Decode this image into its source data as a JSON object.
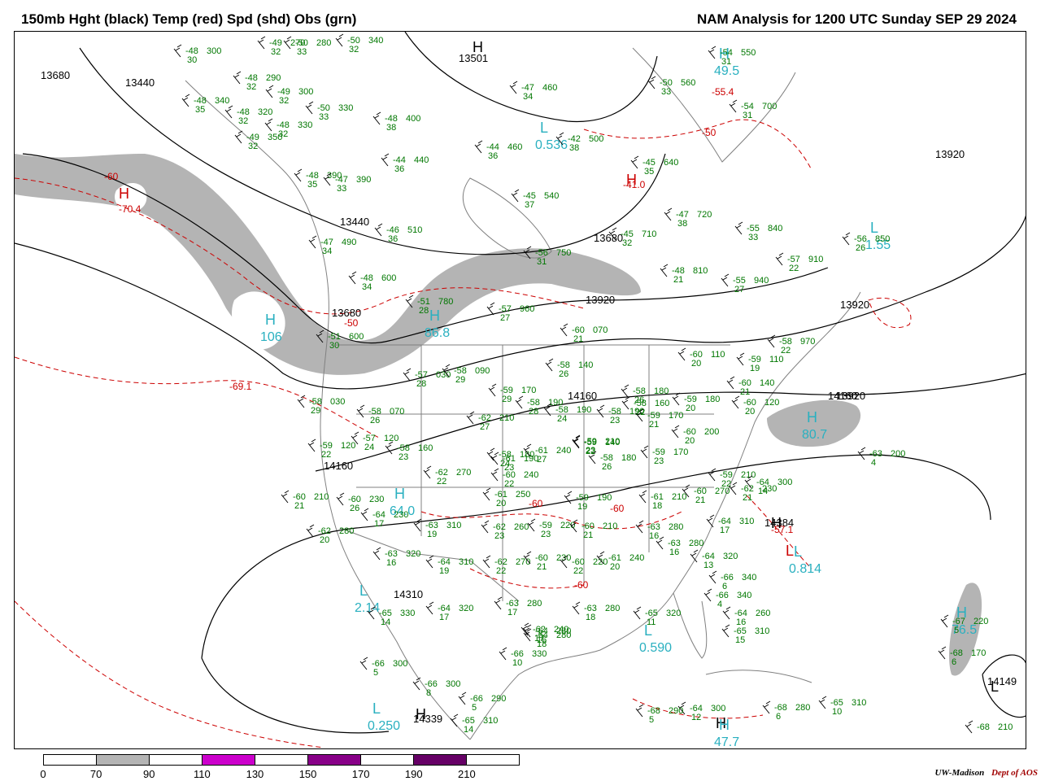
{
  "header": {
    "left_title": "150mb Hght (black) Temp (red) Spd (shd) Obs (grn)",
    "right_title": "NAM Analysis for 1200 UTC Sunday  SEP 29 2024"
  },
  "colors": {
    "height_contour": "#000000",
    "temp_contour": "#cc0000",
    "speed_shade_70_90": "#b4b4b4",
    "obs": "#007700",
    "center_label": "#2ab0c0",
    "map_borders": "#808080"
  },
  "colorbar": {
    "ticks": [
      "0",
      "70",
      "90",
      "110",
      "130",
      "150",
      "170",
      "190",
      "210"
    ],
    "segment_colors": [
      "#ffffff",
      "#b4b4b4",
      "#ffffff",
      "#cc00cc",
      "#ffffff",
      "#880088",
      "#ffffff",
      "#660066",
      "#ffffff"
    ]
  },
  "height_labels": [
    "13680",
    "13440",
    "13501",
    "13920",
    "13680",
    "13440",
    "13920",
    "13680",
    "13920",
    "13920",
    "14160",
    "14160",
    "14160",
    "14160",
    "14384",
    "14310",
    "14339",
    "14149"
  ],
  "temp_labels": [
    "-60",
    "-70.4",
    "-50",
    "-50",
    "-55.4",
    "-41.0",
    "-69.1",
    "-60",
    "-60",
    "-60",
    "-57.1"
  ],
  "centers": [
    {
      "letter": "H",
      "value": "49.5",
      "kind": "speed"
    },
    {
      "letter": "H",
      "value": "",
      "kind": "height"
    },
    {
      "letter": "L",
      "value": "0.536",
      "kind": "speed"
    },
    {
      "letter": "H",
      "value": "",
      "kind": "temp"
    },
    {
      "letter": "H",
      "value": "",
      "kind": "temp"
    },
    {
      "letter": "L",
      "value": "1.55",
      "kind": "speed"
    },
    {
      "letter": "H",
      "value": "106",
      "kind": "speed"
    },
    {
      "letter": "H",
      "value": "86.8",
      "kind": "speed"
    },
    {
      "letter": "H",
      "value": "80.7",
      "kind": "speed"
    },
    {
      "letter": "H",
      "value": "64.0",
      "kind": "speed"
    },
    {
      "letter": "L",
      "value": "",
      "kind": "temp"
    },
    {
      "letter": "H",
      "value": "",
      "kind": "height"
    },
    {
      "letter": "L",
      "value": "0.814",
      "kind": "speed"
    },
    {
      "letter": "L",
      "value": "2.14",
      "kind": "speed"
    },
    {
      "letter": "H",
      "value": "",
      "kind": "height"
    },
    {
      "letter": "L",
      "value": "0.590",
      "kind": "speed"
    },
    {
      "letter": "L",
      "value": "0.250",
      "kind": "speed"
    },
    {
      "letter": "H",
      "value": "",
      "kind": "height"
    },
    {
      "letter": "H",
      "value": "47.7",
      "kind": "speed"
    },
    {
      "letter": "H",
      "value": "76.5",
      "kind": "speed"
    },
    {
      "letter": "L",
      "value": "",
      "kind": "height"
    }
  ],
  "stations": [
    {
      "t": "-48",
      "h": "300",
      "d": "30"
    },
    {
      "t": "-49",
      "h": "270",
      "d": "32"
    },
    {
      "t": "-50",
      "h": "280",
      "d": "33"
    },
    {
      "t": "-50",
      "h": "340",
      "d": "32"
    },
    {
      "t": "-48",
      "h": "290",
      "d": "32"
    },
    {
      "t": "-49",
      "h": "300",
      "d": "32"
    },
    {
      "t": "-48",
      "h": "340",
      "d": "35"
    },
    {
      "t": "-48",
      "h": "320",
      "d": "32"
    },
    {
      "t": "-50",
      "h": "330",
      "d": "33"
    },
    {
      "t": "-48",
      "h": "330",
      "d": "32"
    },
    {
      "t": "-49",
      "h": "350",
      "d": "32"
    },
    {
      "t": "-48",
      "h": "400",
      "d": "38"
    },
    {
      "t": "-47",
      "h": "460",
      "d": "34"
    },
    {
      "t": "-44",
      "h": "460",
      "d": "36"
    },
    {
      "t": "-42",
      "h": "500",
      "d": "38"
    },
    {
      "t": "-44",
      "h": "440",
      "d": "36"
    },
    {
      "t": "-48",
      "h": "390",
      "d": "35"
    },
    {
      "t": "-47",
      "h": "390",
      "d": "33"
    },
    {
      "t": "-45",
      "h": "540",
      "d": "37"
    },
    {
      "t": "-45",
      "h": "640",
      "d": "35"
    },
    {
      "t": "-50",
      "h": "560",
      "d": "33"
    },
    {
      "t": "-54",
      "h": "550",
      "d": "31"
    },
    {
      "t": "-54",
      "h": "700",
      "d": "31"
    },
    {
      "t": "-46",
      "h": "510",
      "d": "36"
    },
    {
      "t": "-47",
      "h": "490",
      "d": "34"
    },
    {
      "t": "-47",
      "h": "720",
      "d": "38"
    },
    {
      "t": "-45",
      "h": "710",
      "d": "32"
    },
    {
      "t": "-55",
      "h": "840",
      "d": "33"
    },
    {
      "t": "-56",
      "h": "850",
      "d": "26"
    },
    {
      "t": "-48",
      "h": "600",
      "d": "34"
    },
    {
      "t": "-56",
      "h": "750",
      "d": "31"
    },
    {
      "t": "-48",
      "h": "810",
      "d": "21"
    },
    {
      "t": "-57",
      "h": "910",
      "d": "22"
    },
    {
      "t": "-55",
      "h": "940",
      "d": "27"
    },
    {
      "t": "-51",
      "h": "780",
      "d": "28"
    },
    {
      "t": "-57",
      "h": "960",
      "d": "27"
    },
    {
      "t": "-60",
      "h": "070",
      "d": "21"
    },
    {
      "t": "-58",
      "h": "970",
      "d": "22"
    },
    {
      "t": "-51",
      "h": "600",
      "d": "30"
    },
    {
      "t": "-57",
      "h": "030",
      "d": "28"
    },
    {
      "t": "-58",
      "h": "090",
      "d": "29"
    },
    {
      "t": "-58",
      "h": "140",
      "d": "26"
    },
    {
      "t": "-60",
      "h": "110",
      "d": "20"
    },
    {
      "t": "-59",
      "h": "110",
      "d": "19"
    },
    {
      "t": "-59",
      "h": "170",
      "d": "29"
    },
    {
      "t": "-58",
      "h": "190",
      "d": "28"
    },
    {
      "t": "-58",
      "h": "190",
      "d": "24"
    },
    {
      "t": "-58",
      "h": "190",
      "d": "23"
    },
    {
      "t": "-58",
      "h": "180",
      "d": "26"
    },
    {
      "t": "-60",
      "h": "140",
      "d": "21"
    },
    {
      "t": "-60",
      "h": "120",
      "d": "20"
    },
    {
      "t": "-58",
      "h": "030",
      "d": "29"
    },
    {
      "t": "-58",
      "h": "070",
      "d": "26"
    },
    {
      "t": "-62",
      "h": "210",
      "d": "27"
    },
    {
      "t": "-58",
      "h": "160",
      "d": "22"
    },
    {
      "t": "-59",
      "h": "170",
      "d": "21"
    },
    {
      "t": "-59",
      "h": "180",
      "d": "20"
    },
    {
      "t": "-60",
      "h": "200",
      "d": "20"
    },
    {
      "t": "-59",
      "h": "120",
      "d": "22"
    },
    {
      "t": "-57",
      "h": "120",
      "d": "24"
    },
    {
      "t": "-58",
      "h": "160",
      "d": "23"
    },
    {
      "t": "-58",
      "h": "180",
      "d": "24"
    },
    {
      "t": "-61",
      "h": "190",
      "d": "23"
    },
    {
      "t": "-61",
      "h": "240",
      "d": "27"
    },
    {
      "t": "-59",
      "h": "210",
      "d": "23"
    },
    {
      "t": "-58",
      "h": "180",
      "d": "26"
    },
    {
      "t": "-59",
      "h": "170",
      "d": "23"
    },
    {
      "t": "-59",
      "h": "140",
      "d": "22"
    },
    {
      "t": "-60",
      "h": "240",
      "d": "22"
    },
    {
      "t": "-62",
      "h": "270",
      "d": "22"
    },
    {
      "t": "-59",
      "h": "210",
      "d": "22"
    },
    {
      "t": "-62",
      "h": "230",
      "d": "21"
    },
    {
      "t": "-60",
      "h": "270",
      "d": "21"
    },
    {
      "t": "-64",
      "h": "300",
      "d": "14"
    },
    {
      "t": "-60",
      "h": "210",
      "d": "21"
    },
    {
      "t": "-60",
      "h": "230",
      "d": "26"
    },
    {
      "t": "-61",
      "h": "250",
      "d": "20"
    },
    {
      "t": "-59",
      "h": "190",
      "d": "19"
    },
    {
      "t": "-61",
      "h": "210",
      "d": "18"
    },
    {
      "t": "-62",
      "h": "280",
      "d": "20"
    },
    {
      "t": "-64",
      "h": "230",
      "d": "17"
    },
    {
      "t": "-63",
      "h": "310",
      "d": "19"
    },
    {
      "t": "-62",
      "h": "260",
      "d": "23"
    },
    {
      "t": "-59",
      "h": "220",
      "d": "23"
    },
    {
      "t": "-60",
      "h": "210",
      "d": "21"
    },
    {
      "t": "-63",
      "h": "280",
      "d": "16"
    },
    {
      "t": "-63",
      "h": "280",
      "d": "16"
    },
    {
      "t": "-64",
      "h": "310",
      "d": "17"
    },
    {
      "t": "-63",
      "h": "320",
      "d": "16"
    },
    {
      "t": "-64",
      "h": "310",
      "d": "19"
    },
    {
      "t": "-62",
      "h": "270",
      "d": "22"
    },
    {
      "t": "-60",
      "h": "230",
      "d": "21"
    },
    {
      "t": "-60",
      "h": "220",
      "d": "22"
    },
    {
      "t": "-61",
      "h": "240",
      "d": "20"
    },
    {
      "t": "-64",
      "h": "320",
      "d": "13"
    },
    {
      "t": "-66",
      "h": "340",
      "d": "6"
    },
    {
      "t": "-65",
      "h": "330",
      "d": "14"
    },
    {
      "t": "-64",
      "h": "320",
      "d": "17"
    },
    {
      "t": "-63",
      "h": "280",
      "d": "17"
    },
    {
      "t": "-62",
      "h": "240",
      "d": "17"
    },
    {
      "t": "-63",
      "h": "280",
      "d": "18"
    },
    {
      "t": "-65",
      "h": "320",
      "d": "11"
    },
    {
      "t": "-66",
      "h": "340",
      "d": "4"
    },
    {
      "t": "-64",
      "h": "260",
      "d": "16"
    },
    {
      "t": "-64",
      "h": "280",
      "d": "16"
    },
    {
      "t": "-64",
      "h": "280",
      "d": "18"
    },
    {
      "t": "-66",
      "h": "330",
      "d": "10"
    },
    {
      "t": "-65",
      "h": "310",
      "d": "15"
    },
    {
      "t": "-66",
      "h": "300",
      "d": "5"
    },
    {
      "t": "-66",
      "h": "300",
      "d": "8"
    },
    {
      "t": "-66",
      "h": "290",
      "d": "5"
    },
    {
      "t": "-65",
      "h": "310",
      "d": "14"
    },
    {
      "t": "-64",
      "h": "300",
      "d": "12"
    },
    {
      "t": "-68",
      "h": "290",
      "d": "5"
    },
    {
      "t": "-68",
      "h": "280",
      "d": "6"
    },
    {
      "t": "-65",
      "h": "310",
      "d": "10"
    },
    {
      "t": "-63",
      "h": "200",
      "d": "4"
    },
    {
      "t": "-67",
      "h": "220",
      "d": "5"
    },
    {
      "t": "-68",
      "h": "170",
      "d": "6"
    },
    {
      "t": "-68",
      "h": "210",
      "d": ""
    }
  ],
  "credit": {
    "org": "UW-Madison",
    "dept": "Dept of AOS"
  }
}
